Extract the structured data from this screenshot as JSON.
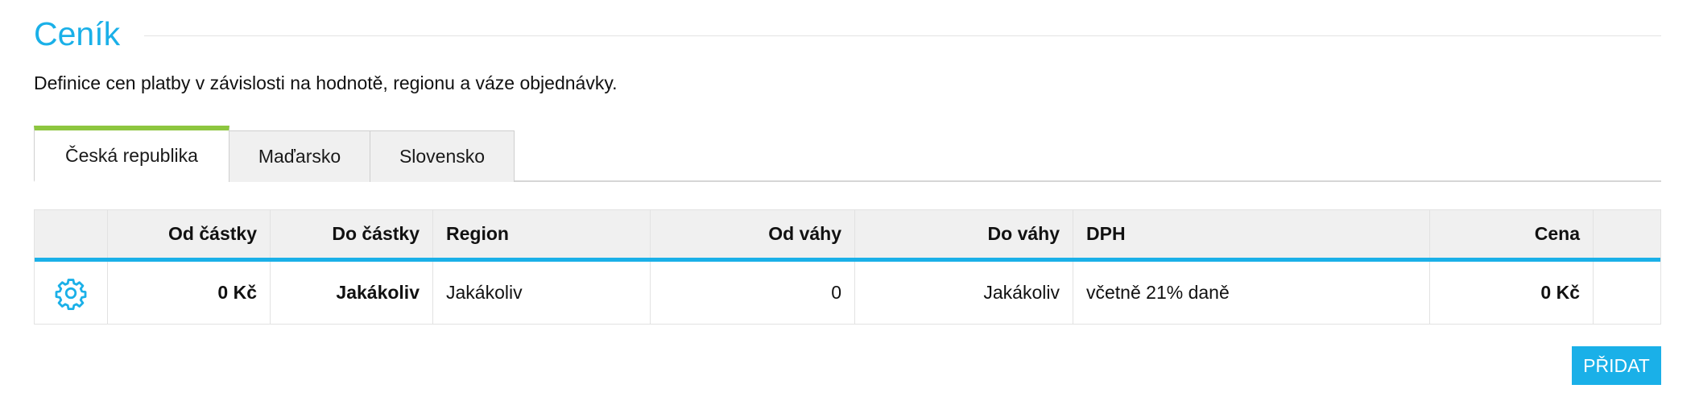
{
  "header": {
    "title": "Ceník"
  },
  "description": "Definice cen platby v závislosti na hodnotě, regionu a váze objednávky.",
  "tabs": [
    {
      "label": "Česká republika",
      "active": true
    },
    {
      "label": "Maďarsko",
      "active": false
    },
    {
      "label": "Slovensko",
      "active": false
    }
  ],
  "table": {
    "columns": [
      "",
      "Od částky",
      "Do částky",
      "Region",
      "Od váhy",
      "Do váhy",
      "DPH",
      "Cena",
      ""
    ],
    "rows": [
      {
        "icon": "gear-icon",
        "from_amount": "0 Kč",
        "to_amount": "Jakákoliv",
        "region": "Jakákoliv",
        "from_weight": "0",
        "to_weight": "Jakákoliv",
        "vat": "včetně 21% daně",
        "price": "0 Kč"
      }
    ]
  },
  "actions": {
    "add_label": "PŘIDAT"
  },
  "colors": {
    "accent": "#1ab0e8",
    "active_tab_bar": "#8dc63f",
    "header_bg": "#f0f0f0"
  }
}
